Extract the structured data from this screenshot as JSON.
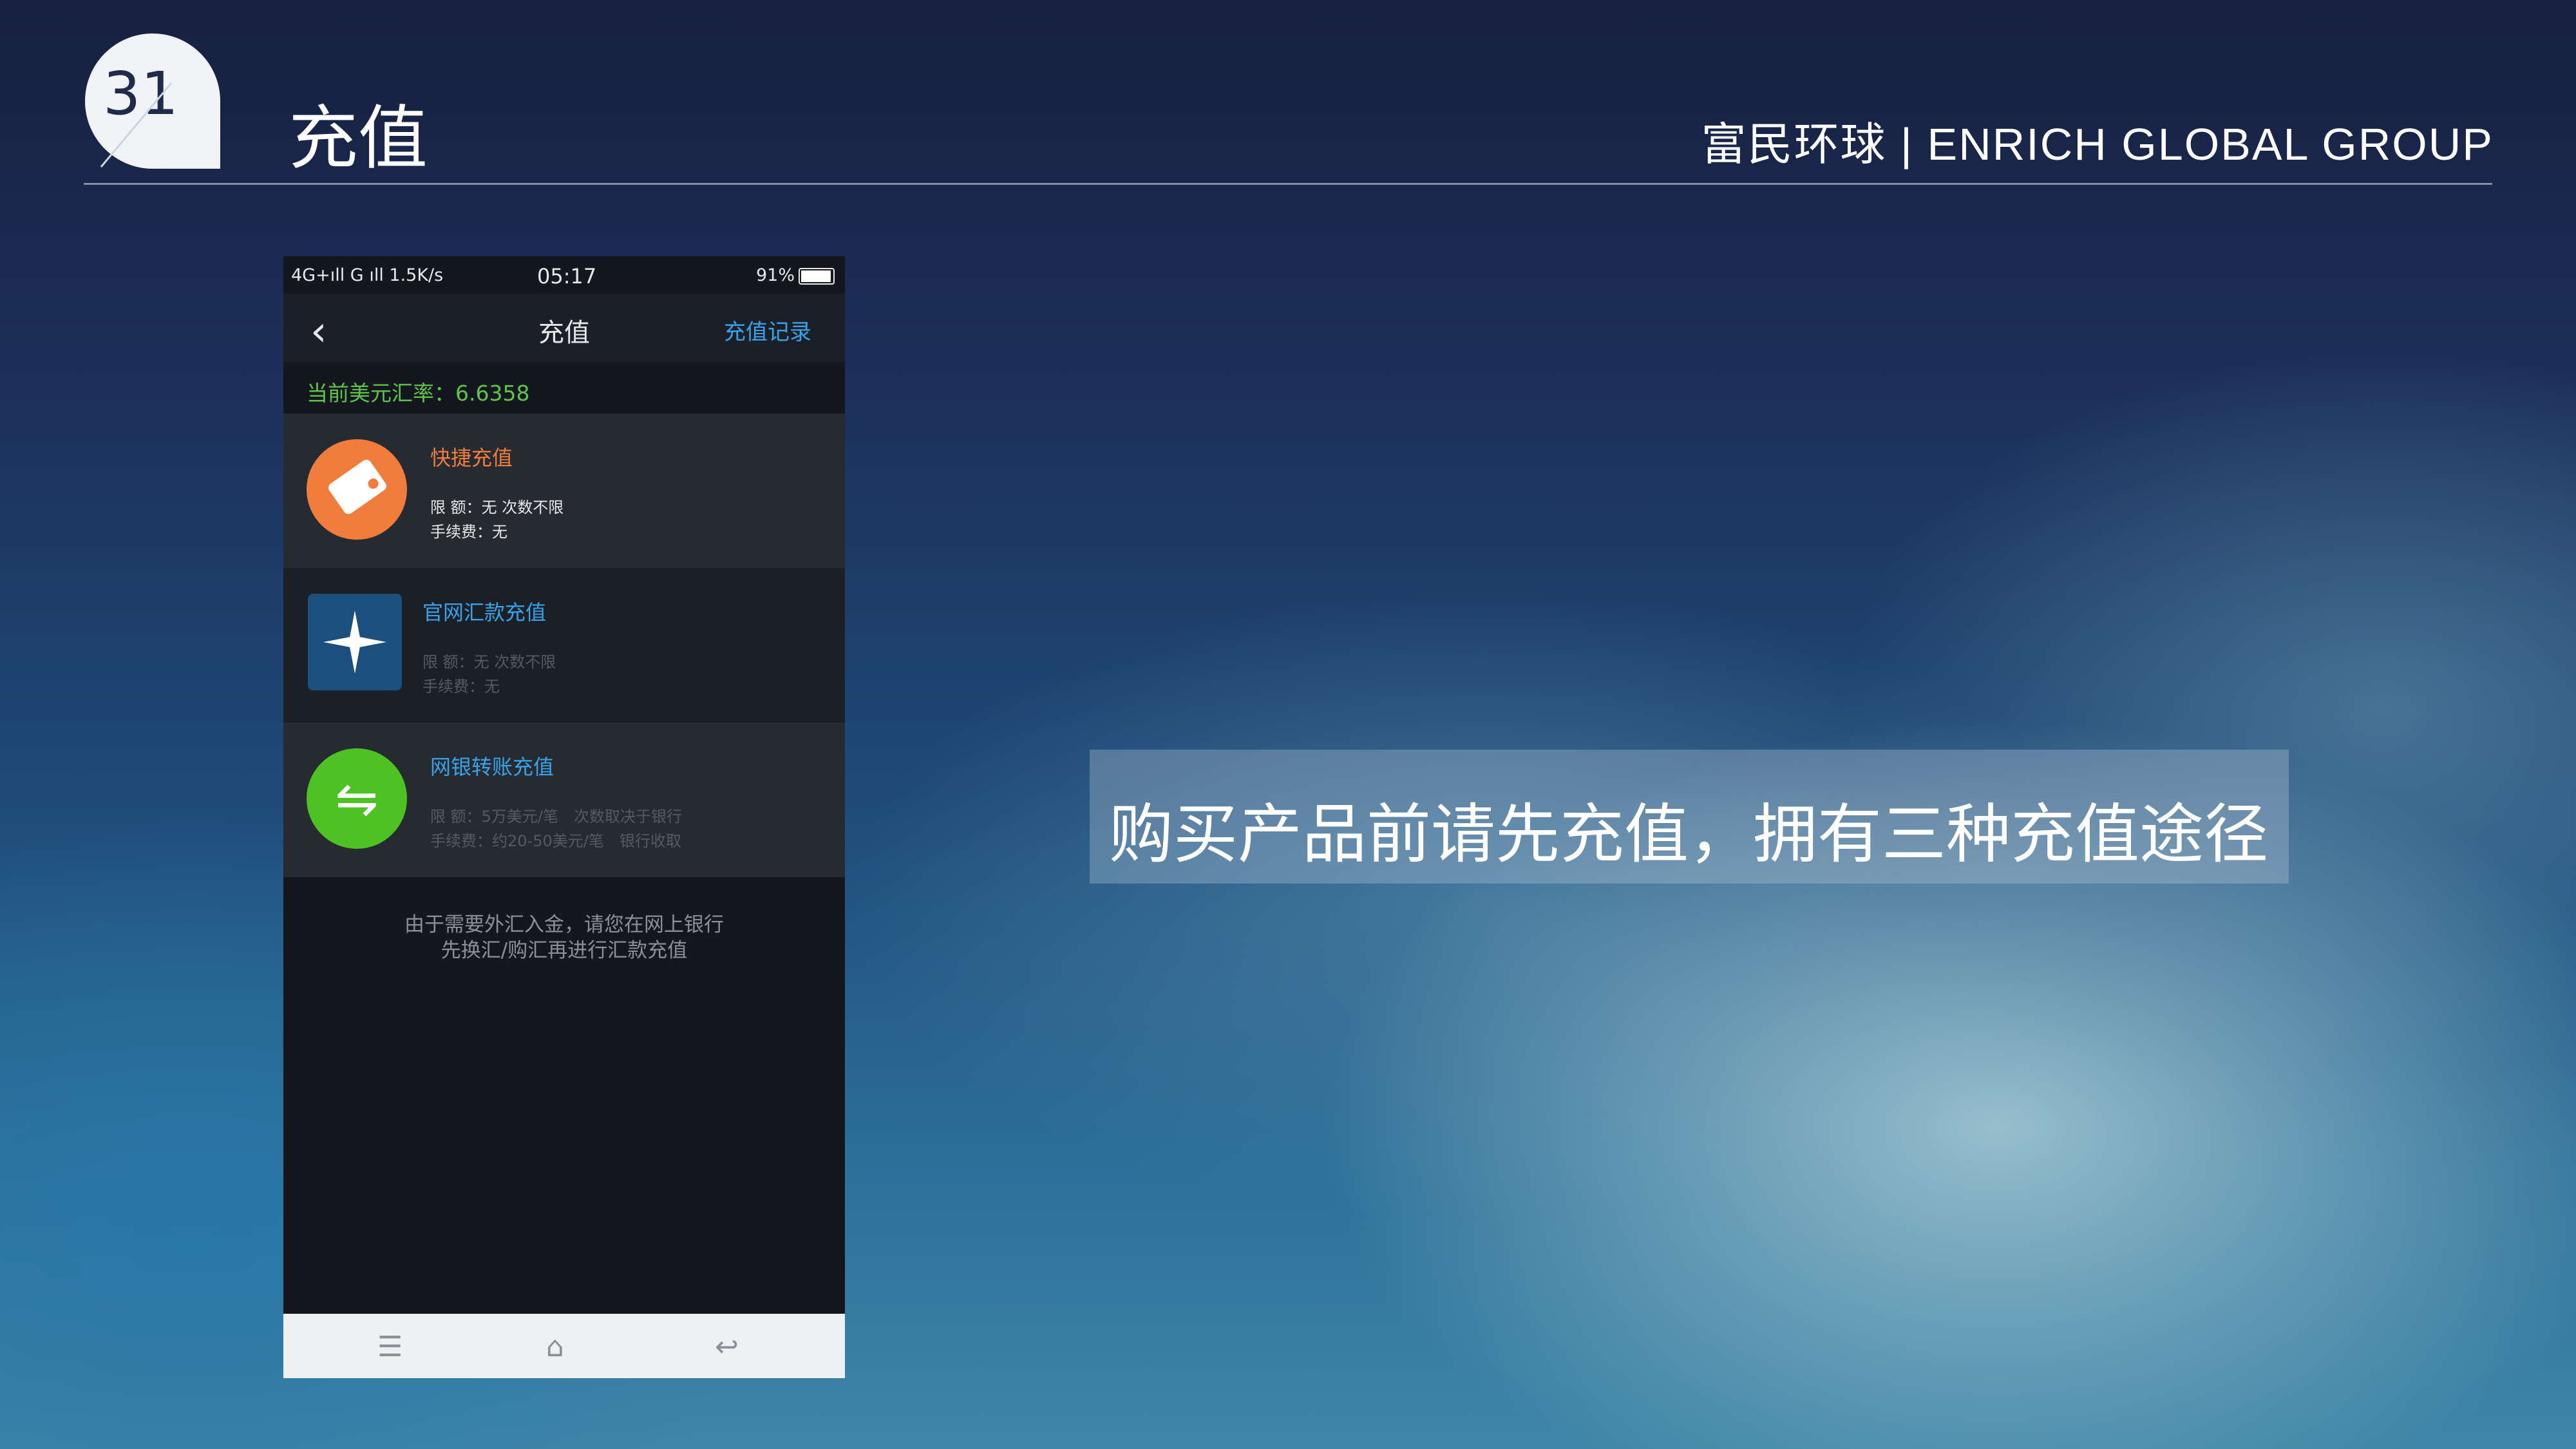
{
  "slide": {
    "number": "31",
    "title": "充值",
    "brand": "富民环球 | ENRICH GLOBAL GROUP"
  },
  "phone": {
    "status_bar": {
      "left": "4G+ıll G ıll 1.5K/s",
      "time": "05:17",
      "battery": "91%"
    },
    "nav": {
      "title": "充值",
      "right_link": "充值记录"
    },
    "exchange_rate": "当前美元汇率：6.6358",
    "methods": [
      {
        "title": "快捷充值",
        "line1": "限 额：无 次数不限",
        "line2": "手续费：无",
        "icon": "card-icon",
        "accent": "#f07d3c"
      },
      {
        "title": "官网汇款充值",
        "line1": "限 额：无 次数不限",
        "line2": "手续费：无",
        "icon": "sparkle-icon",
        "accent": "#1d4f7c"
      },
      {
        "title": "网银转账充值",
        "line1": "限 额：5万美元/笔　次数取决于银行",
        "line2": "手续费：约20-50美元/笔　银行收取",
        "icon": "transfer-arrows-icon",
        "accent": "#4fc223"
      }
    ],
    "note_line1": "由于需要外汇入金，请您在网上银行",
    "note_line2": "先换汇/购汇再进行汇款充值",
    "softkeys": [
      "menu-icon",
      "home-icon",
      "back-return-icon"
    ]
  },
  "callout": "购买产品前请先充值，拥有三种充值途径"
}
